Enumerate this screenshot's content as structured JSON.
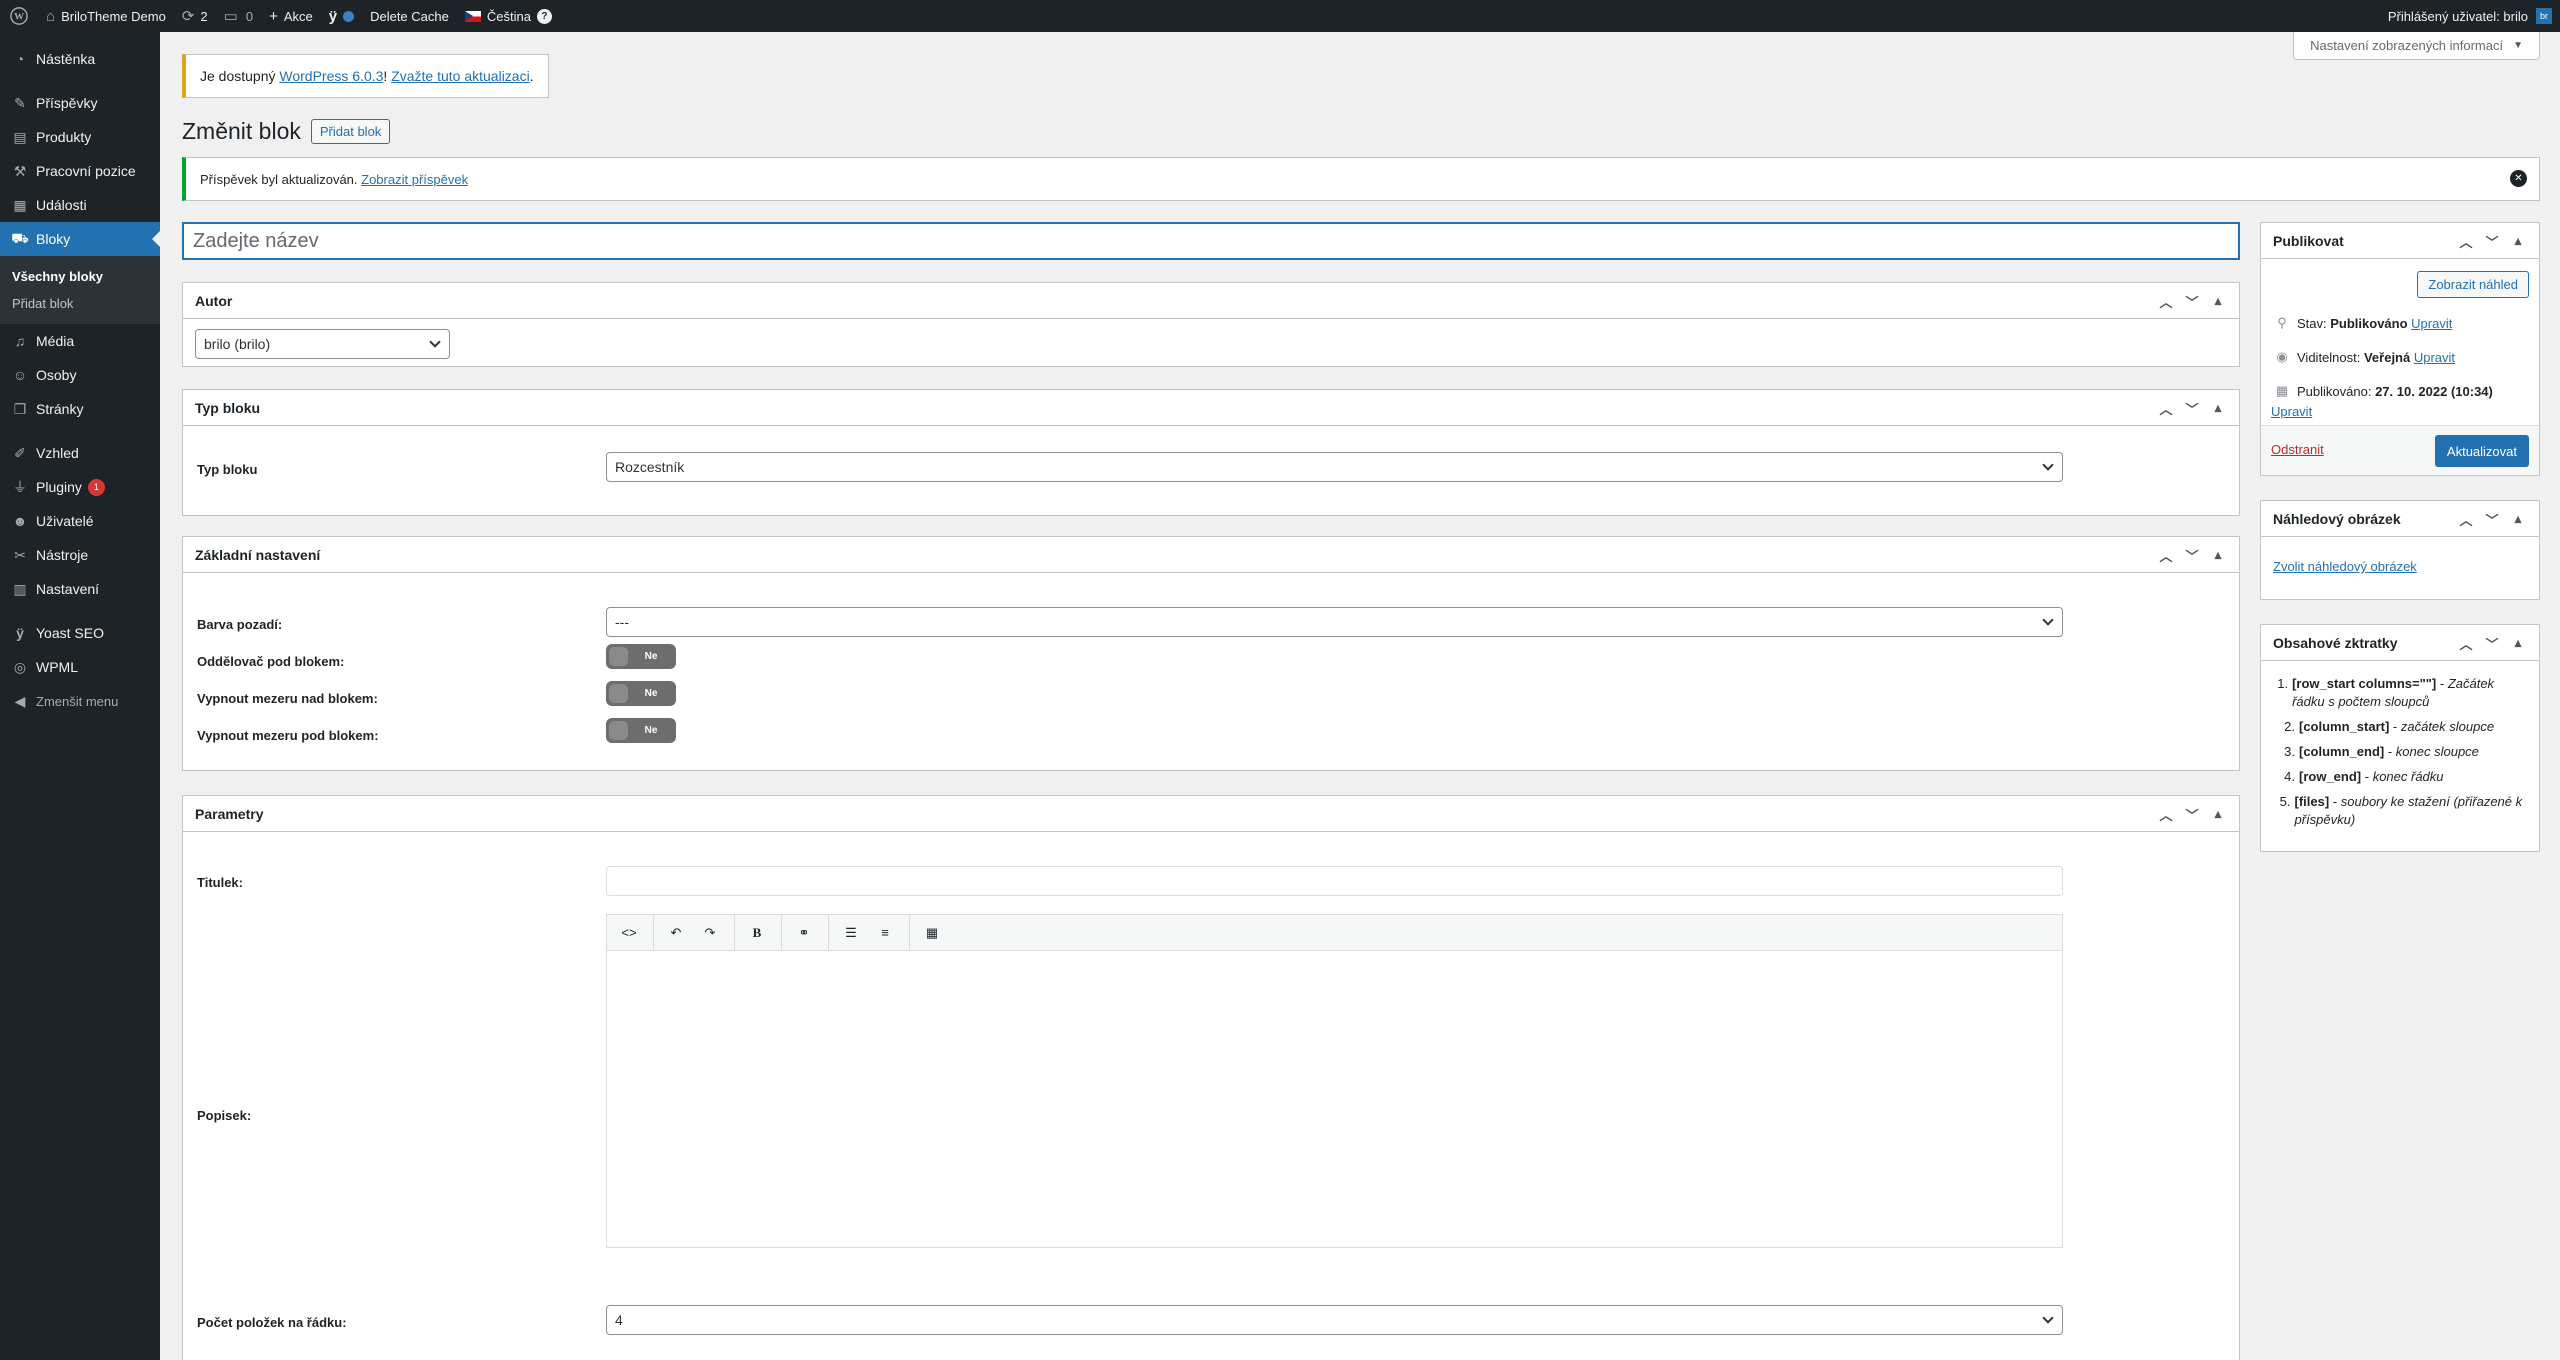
{
  "admin_bar": {
    "site_name": "BriloTheme Demo",
    "updates_count": "2",
    "comments_count": "0",
    "new_label": "Akce",
    "delete_cache": "Delete Cache",
    "language": "Čeština",
    "help_icon": "?",
    "logged_in": "Přihlášený uživatel: brilo",
    "avatar_text": "br"
  },
  "sidebar": {
    "items": [
      {
        "label": "Nástěnka",
        "icon": "dashboard-icon"
      },
      {
        "label": "Příspěvky",
        "icon": "pin-icon"
      },
      {
        "label": "Produkty",
        "icon": "products-icon"
      },
      {
        "label": "Pracovní pozice",
        "icon": "hammer-icon"
      },
      {
        "label": "Události",
        "icon": "calendar-icon"
      },
      {
        "label": "Bloky",
        "icon": "cart-icon"
      },
      {
        "label": "Média",
        "icon": "media-icon"
      },
      {
        "label": "Osoby",
        "icon": "person-icon"
      },
      {
        "label": "Stránky",
        "icon": "pages-icon"
      },
      {
        "label": "Vzhled",
        "icon": "brush-icon"
      },
      {
        "label": "Pluginy",
        "icon": "plugin-icon",
        "badge": "1"
      },
      {
        "label": "Uživatelé",
        "icon": "users-icon"
      },
      {
        "label": "Nástroje",
        "icon": "wrench-icon"
      },
      {
        "label": "Nastavení",
        "icon": "settings-icon"
      },
      {
        "label": "Yoast SEO",
        "icon": "yoast-icon"
      },
      {
        "label": "WPML",
        "icon": "wpml-icon"
      },
      {
        "label": "Zmenšit menu",
        "icon": "collapse-icon"
      }
    ],
    "submenu": [
      "Všechny bloky",
      "Přidat blok"
    ]
  },
  "screen_options": "Nastavení zobrazených informací",
  "update_nag": {
    "prefix": "Je dostupný ",
    "link1": "WordPress 6.0.3",
    "middle": "! ",
    "link2": "Zvažte tuto aktualizaci",
    "suffix": "."
  },
  "page": {
    "title": "Změnit blok",
    "add_new": "Přidat blok"
  },
  "notice": {
    "text": "Příspěvek byl aktualizován. ",
    "link": "Zobrazit příspěvek"
  },
  "title_input": {
    "placeholder": "Zadejte název",
    "value": ""
  },
  "author_box": {
    "title": "Autor",
    "selected": "brilo (brilo)"
  },
  "block_type_box": {
    "title": "Typ bloku",
    "label": "Typ bloku",
    "selected": "Rozcestník"
  },
  "basic_settings_box": {
    "title": "Základní nastavení",
    "bg_color_label": "Barva pozadí:",
    "bg_color_value": "---",
    "divider_label": "Oddělovač pod blokem:",
    "disable_top_label": "Vypnout mezeru nad blokem:",
    "disable_bottom_label": "Vypnout mezeru pod blokem:",
    "toggle_text": "Ne"
  },
  "params_box": {
    "title": "Parametry",
    "title_label": "Titulek:",
    "title_value": "",
    "description_label": "Popisek:",
    "items_label": "Počet položek na řádku:",
    "items_value": "4",
    "toolbar": [
      "code-icon",
      "undo-icon",
      "redo-icon",
      "bold-icon",
      "link-icon",
      "bullet-list-icon",
      "numbered-list-icon",
      "table-icon"
    ]
  },
  "publish_box": {
    "title": "Publikovat",
    "preview_label": "Zobrazit náhled",
    "status_label": "Stav: ",
    "status_value": "Publikováno",
    "visibility_label": "Viditelnost: ",
    "visibility_value": "Veřejná",
    "published_label": "Publikováno: ",
    "published_value": "27. 10. 2022 (10:34)",
    "edit_link": "Upravit",
    "delete_label": "Odstranit",
    "update_label": "Aktualizovat"
  },
  "featured_box": {
    "title": "Náhledový obrázek",
    "link": "Zvolit náhledový obrázek"
  },
  "shortcodes_box": {
    "title": "Obsahové zktratky",
    "items": [
      {
        "num": "1.",
        "code": "[row_start columns=\"\"]",
        "desc": "Začátek řádku s počtem sloupců"
      },
      {
        "num": "2.",
        "code": "[column_start]",
        "desc": "začátek sloupce"
      },
      {
        "num": "3.",
        "code": "[column_end]",
        "desc": "konec sloupce"
      },
      {
        "num": "4.",
        "code": "[row_end]",
        "desc": "konec řádku"
      },
      {
        "num": "5.",
        "code": "[files]",
        "desc": "soubory ke stažení (přiřazené k příspěvku)"
      }
    ]
  }
}
